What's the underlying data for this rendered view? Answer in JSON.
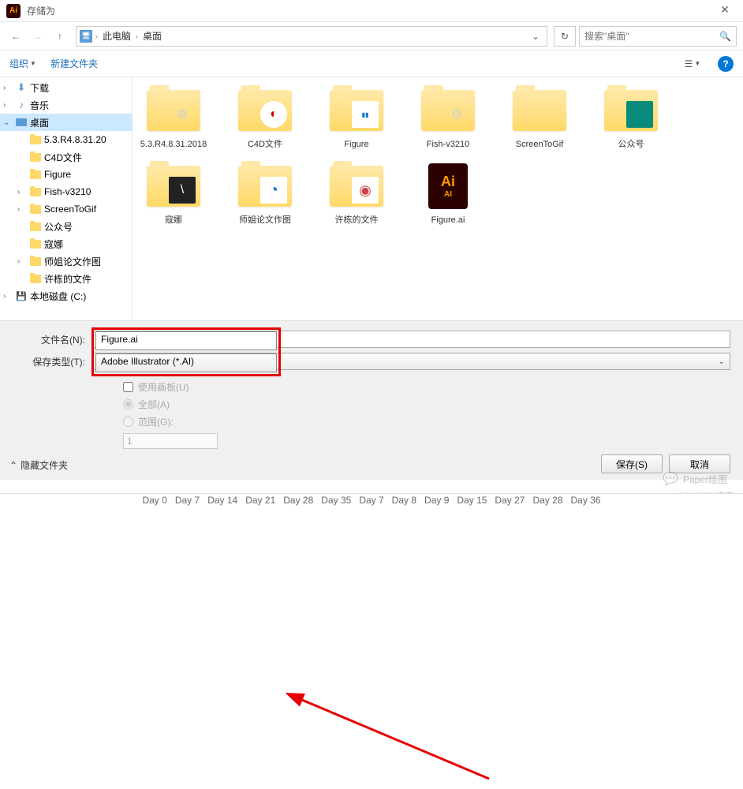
{
  "titlebar": {
    "app_icon": "Ai",
    "title": "存储为"
  },
  "nav": {
    "breadcrumb_root": "此电脑",
    "breadcrumb_current": "桌面",
    "search_placeholder": "搜索\"桌面\""
  },
  "toolbar": {
    "organize": "组织",
    "new_folder": "新建文件夹"
  },
  "sidebar": {
    "items": [
      {
        "label": "下载",
        "icon": "download",
        "chev": "›",
        "indent": 0
      },
      {
        "label": "音乐",
        "icon": "music",
        "chev": "›",
        "indent": 0
      },
      {
        "label": "桌面",
        "icon": "desktop",
        "chev": "⌄",
        "indent": 0,
        "selected": true
      },
      {
        "label": "5.3.R4.8.31.20",
        "icon": "folder",
        "chev": "",
        "indent": 1
      },
      {
        "label": "C4D文件",
        "icon": "folder",
        "chev": "",
        "indent": 1
      },
      {
        "label": "Figure",
        "icon": "folder",
        "chev": "",
        "indent": 1
      },
      {
        "label": "Fish-v3210",
        "icon": "folder",
        "chev": "›",
        "indent": 1
      },
      {
        "label": "ScreenToGif",
        "icon": "folder",
        "chev": "›",
        "indent": 1
      },
      {
        "label": "公众号",
        "icon": "folder",
        "chev": "",
        "indent": 1
      },
      {
        "label": "寇娜",
        "icon": "folder",
        "chev": "",
        "indent": 1
      },
      {
        "label": "师姐论文作图",
        "icon": "folder",
        "chev": "›",
        "indent": 1
      },
      {
        "label": "许栋的文件",
        "icon": "folder",
        "chev": "",
        "indent": 1
      },
      {
        "label": "本地磁盘 (C:)",
        "icon": "disk",
        "chev": "›",
        "indent": 0
      }
    ]
  },
  "content": {
    "items": [
      {
        "label": "5.3.R4.8.31.2018",
        "type": "folder-gear"
      },
      {
        "label": "C4D文件",
        "type": "folder-logo"
      },
      {
        "label": "Figure",
        "type": "folder-preview"
      },
      {
        "label": "Fish-v3210",
        "type": "folder-gear"
      },
      {
        "label": "ScreenToGif",
        "type": "folder-plain"
      },
      {
        "label": "公众号",
        "type": "folder-green"
      },
      {
        "label": "寇娜",
        "type": "folder-dark"
      },
      {
        "label": "师姐论文作图",
        "type": "folder-blue"
      },
      {
        "label": "许栋的文件",
        "type": "folder-doc"
      },
      {
        "label": "Figure.ai",
        "type": "ai-file"
      }
    ]
  },
  "form": {
    "filename_label": "文件名(N):",
    "filename_value": "Figure.ai",
    "filetype_label": "保存类型(T):",
    "filetype_value": "Adobe Illustrator (*.AI)",
    "use_artboard": "使用画板(U)",
    "all": "全部(A)",
    "range": "范围(G):",
    "range_value": "1"
  },
  "footer": {
    "hide": "隐藏文件夹",
    "save": "保存(S)",
    "cancel": "取消"
  },
  "watermark": "Paper绘图",
  "watermark2": "@51CTO博客",
  "days": [
    "Day 0",
    "Day 7",
    "Day 14",
    "Day 21",
    "Day 28",
    "Day 35",
    "Day 7",
    "Day 8",
    "Day 9",
    "Day 15",
    "Day 27",
    "Day 28",
    "Day 36"
  ]
}
